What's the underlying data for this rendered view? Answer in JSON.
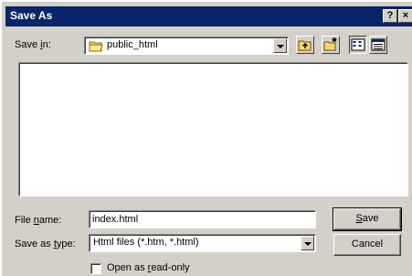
{
  "window": {
    "title": "Save As",
    "help_label": "?",
    "close_label": "×"
  },
  "save_in": {
    "label_pre": "Save ",
    "label_accel": "i",
    "label_post": "n:",
    "value": "public_html",
    "icon": "folder-icon"
  },
  "toolbar": {
    "buttons": [
      "up-one-level-icon",
      "create-new-folder-icon",
      "list-view-icon",
      "details-view-icon"
    ]
  },
  "file_name": {
    "label_pre": "File ",
    "label_accel": "n",
    "label_post": "ame:",
    "value": "index.html"
  },
  "save_as_type": {
    "label_pre": "Save as ",
    "label_accel": "t",
    "label_post": "ype:",
    "value": "Html files (*.htm, *.html)"
  },
  "buttons": {
    "save_accel": "S",
    "save_rest": "ave",
    "cancel": "Cancel"
  },
  "read_only": {
    "label_pre": "Open as ",
    "label_accel": "r",
    "label_post": "ead-only",
    "checked": false
  },
  "colors": {
    "titlebar": "#0a246a",
    "dialog_face": "#d4d0c8",
    "folder": "#f5d76e"
  }
}
